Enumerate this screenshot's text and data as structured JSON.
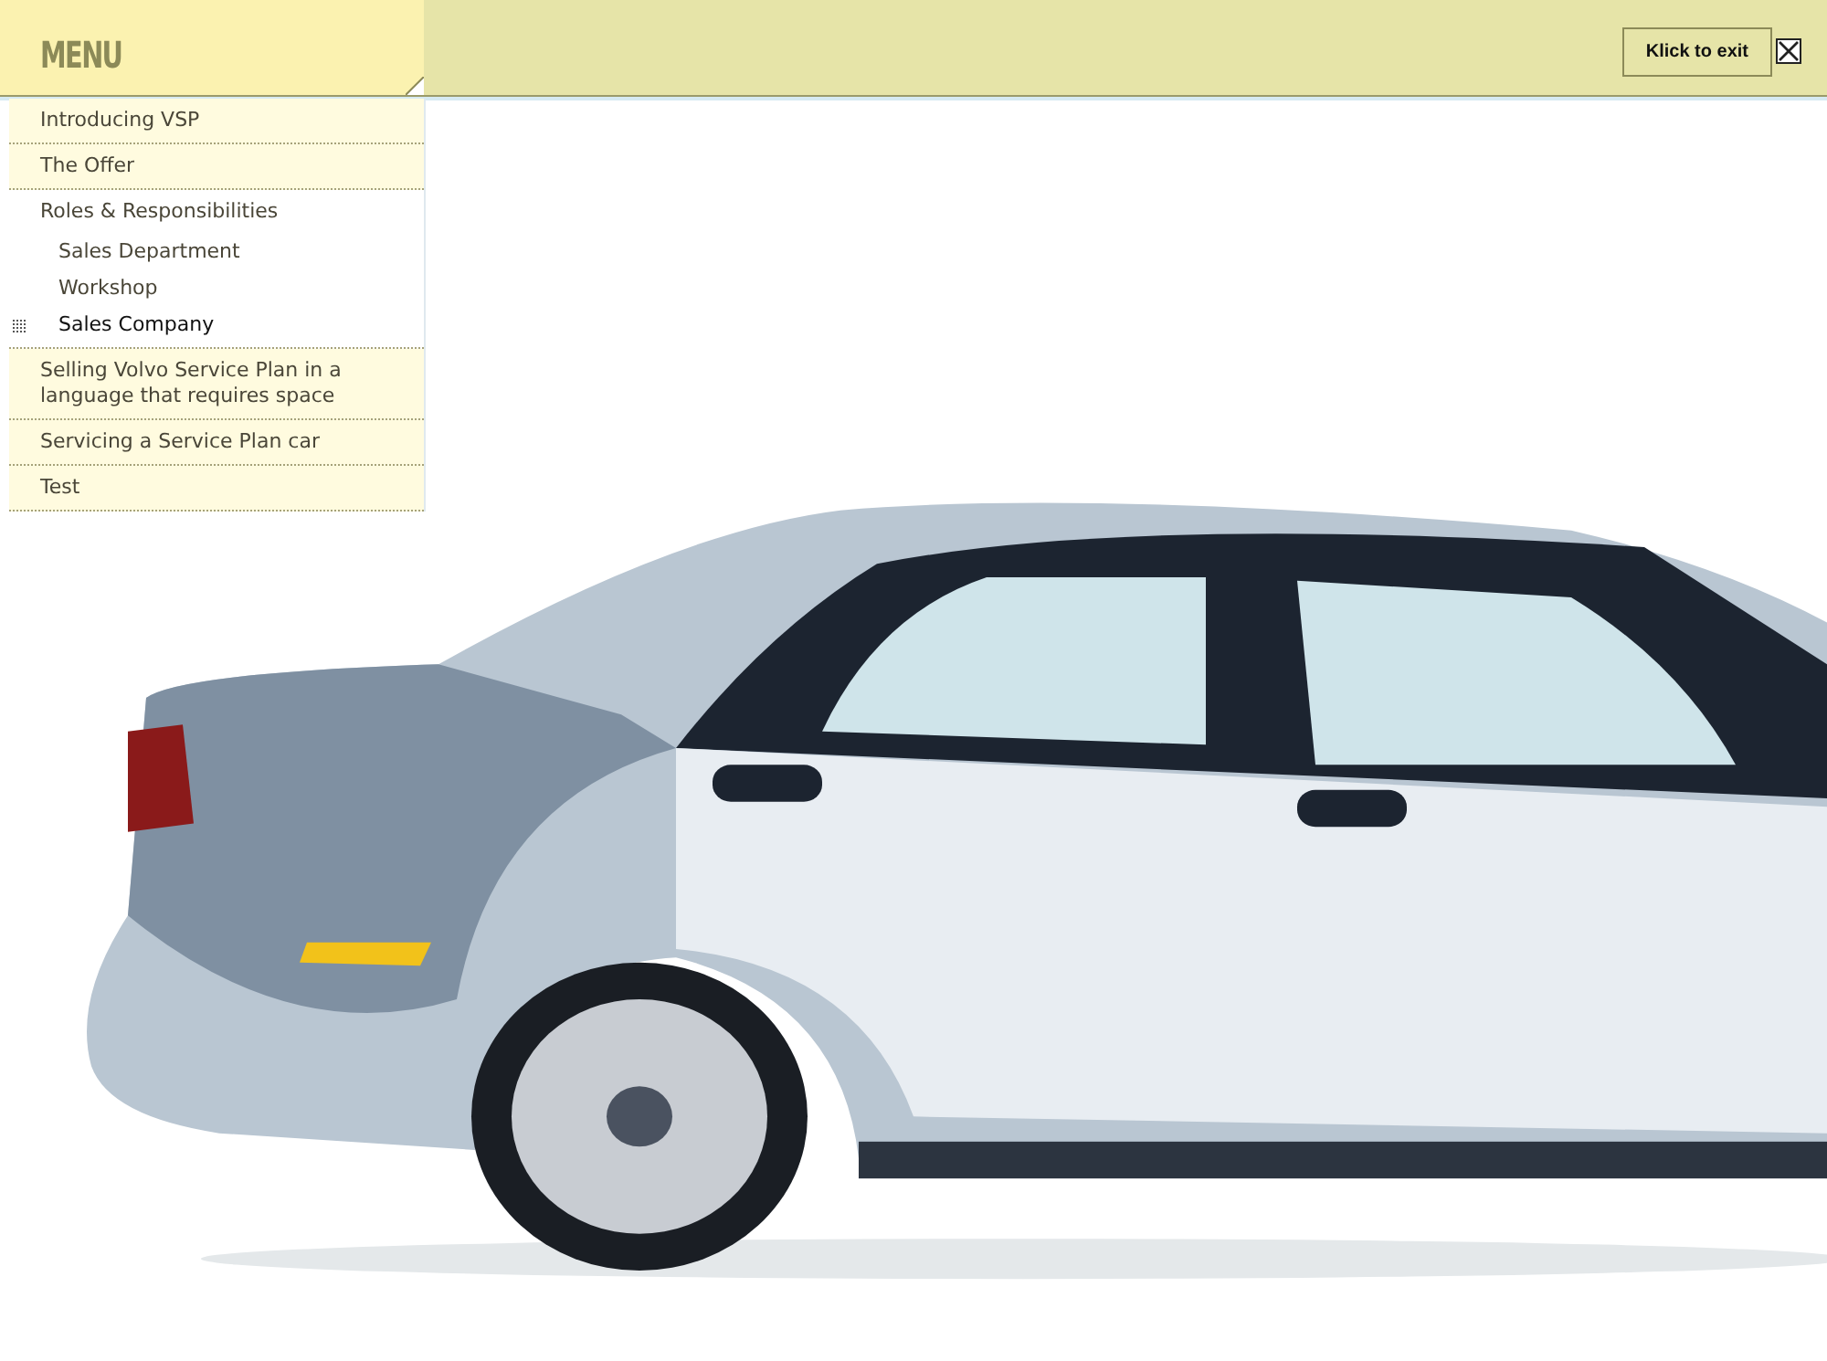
{
  "menu": {
    "title": "MENU",
    "items": [
      {
        "label": "Introducing VSP",
        "selected": false
      },
      {
        "label": "The Offer",
        "selected": false
      },
      {
        "label": "Roles & Responsibilities",
        "selected": false,
        "children": [
          {
            "label": "Sales Department",
            "selected": false
          },
          {
            "label": "Workshop",
            "selected": false
          },
          {
            "label": "Sales Company",
            "selected": true
          }
        ]
      },
      {
        "label": "Selling Volvo Service Plan in a language that requires space",
        "selected": false
      },
      {
        "label": "Servicing a Service Plan car",
        "selected": false
      },
      {
        "label": "Test",
        "selected": false
      }
    ]
  },
  "exit": {
    "label": "Klick to exit"
  }
}
